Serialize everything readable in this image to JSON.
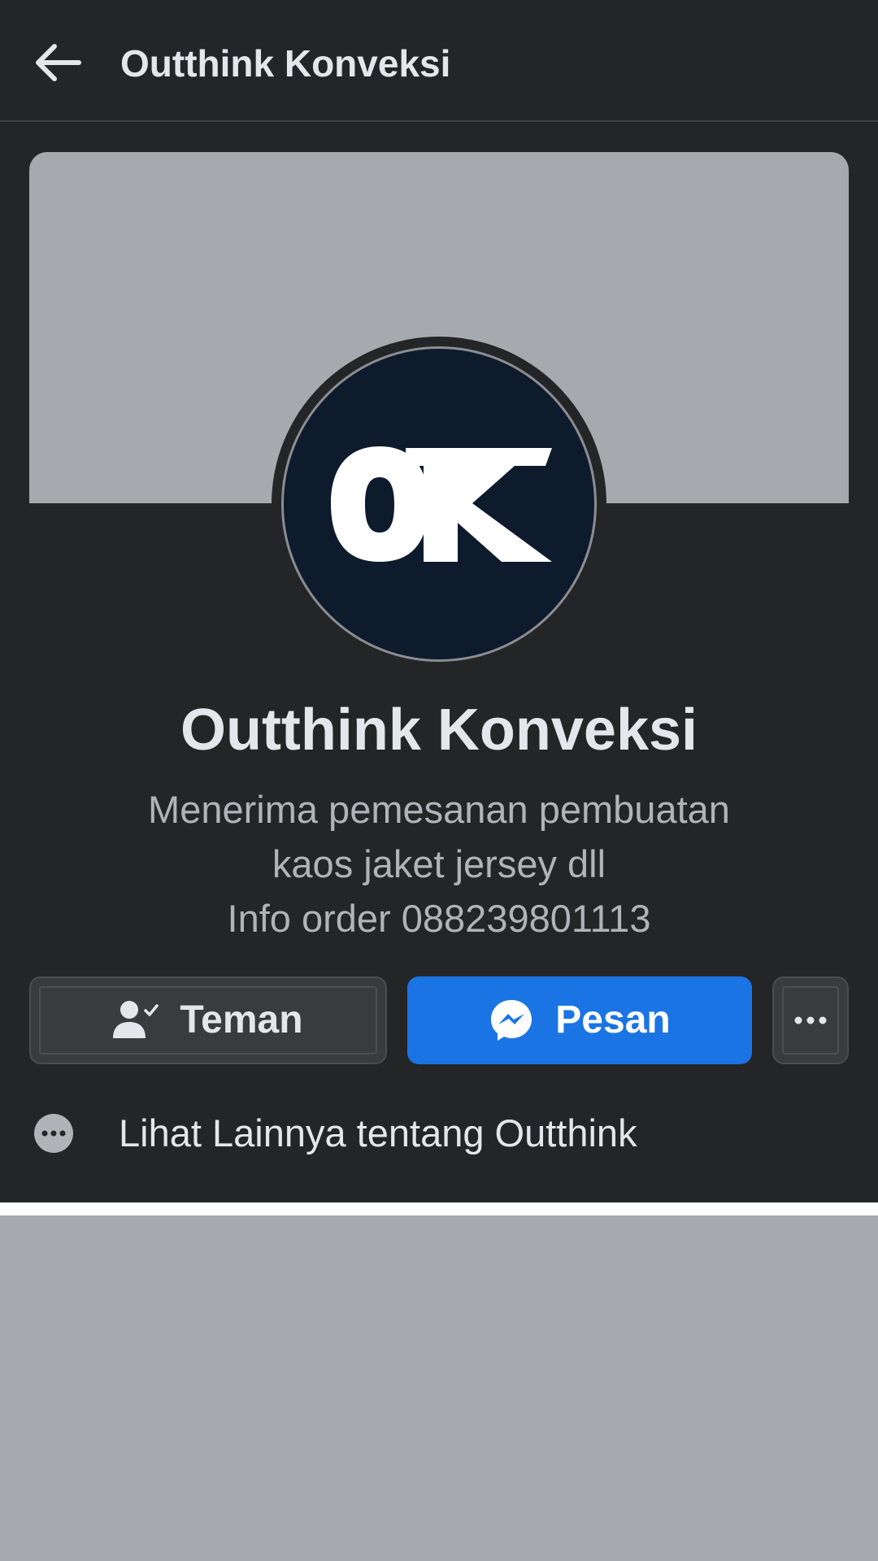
{
  "header": {
    "back_icon": "arrow-left-icon",
    "title": "Outthink Konveksi"
  },
  "profile": {
    "avatar_logo_text": "OK",
    "name": "Outthink Konveksi",
    "bio": [
      "Menerima pemesanan pembuatan",
      "kaos jaket jersey dll",
      "Info order 088239801113"
    ]
  },
  "actions": {
    "friend": {
      "label": "Teman",
      "icon": "friend-check-icon"
    },
    "message": {
      "label": "Pesan",
      "icon": "messenger-icon"
    },
    "more": {
      "icon": "more-dots-icon"
    }
  },
  "see_more": {
    "label": "Lihat Lainnya tentang Outthink",
    "icon": "more-circle-icon"
  },
  "colors": {
    "background": "#242526",
    "cover": "#a6a9ad",
    "primary_button": "#1b74e4",
    "secondary_button": "#3a3b3c",
    "avatar_bg": "#0d1b2d",
    "text_primary": "#e4e6eb",
    "text_secondary": "#b0b3b8"
  }
}
